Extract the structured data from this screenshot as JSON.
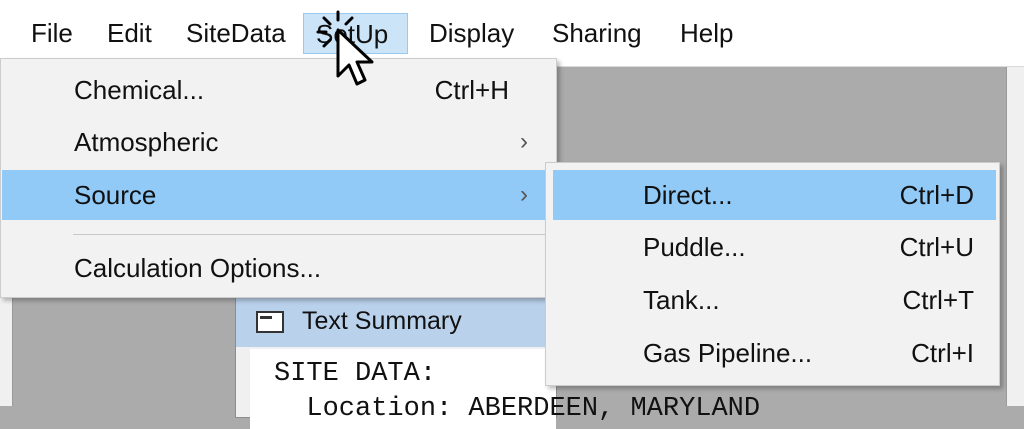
{
  "menubar": {
    "items": [
      {
        "label": "File"
      },
      {
        "label": "Edit"
      },
      {
        "label": "SiteData"
      },
      {
        "label": "SetUp"
      },
      {
        "label": "Display"
      },
      {
        "label": "Sharing"
      },
      {
        "label": "Help"
      }
    ],
    "active_index": 3
  },
  "setup_menu": {
    "items": [
      {
        "label": "Chemical...",
        "shortcut": "Ctrl+H"
      },
      {
        "label": "Atmospheric",
        "has_submenu": true,
        "arrow": "›"
      },
      {
        "label": "Source",
        "has_submenu": true,
        "arrow": "›",
        "highlighted": true
      },
      {
        "label": "Calculation Options..."
      }
    ]
  },
  "source_submenu": {
    "items": [
      {
        "label": "Direct...",
        "shortcut": "Ctrl+D",
        "highlighted": true
      },
      {
        "label": "Puddle...",
        "shortcut": "Ctrl+U"
      },
      {
        "label": "Tank...",
        "shortcut": "Ctrl+T"
      },
      {
        "label": "Gas Pipeline...",
        "shortcut": "Ctrl+I"
      }
    ]
  },
  "text_summary_window": {
    "title": "Text Summary",
    "lines": [
      "SITE DATA:",
      "  Location: ABERDEEN, MARYLAND"
    ]
  },
  "colors": {
    "menu_highlight": "#91c9f7",
    "menubar_active": "#cce4f7",
    "workspace": "#ababab",
    "titlebar": "#b9d1ea"
  },
  "cursor": {
    "icon": "pointer-arrow-click-icon"
  }
}
